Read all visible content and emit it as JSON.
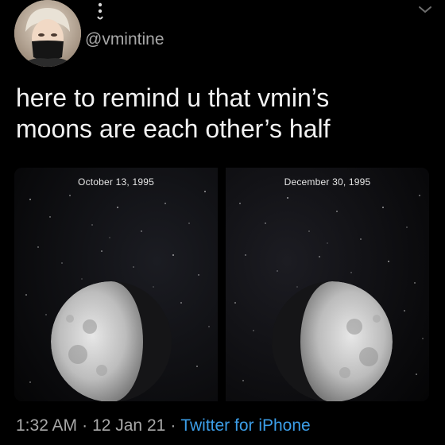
{
  "user": {
    "handle": "@vmintine"
  },
  "tweet": {
    "text_line1": "here to remind u that vmin’s",
    "text_line2": "moons are each other’s half"
  },
  "media": {
    "left_caption": "October 13, 1995",
    "right_caption": "December 30, 1995"
  },
  "meta": {
    "time": "1:32 AM",
    "date": "12 Jan 21",
    "separator": "·",
    "source": "Twitter for iPhone"
  },
  "colors": {
    "background": "#000000",
    "text": "#f2f2f2",
    "secondary": "#a8a8a8",
    "link": "#3c9ee8"
  },
  "icons": [
    "avatar",
    "chevron-down-icon",
    "emoji-icon"
  ]
}
